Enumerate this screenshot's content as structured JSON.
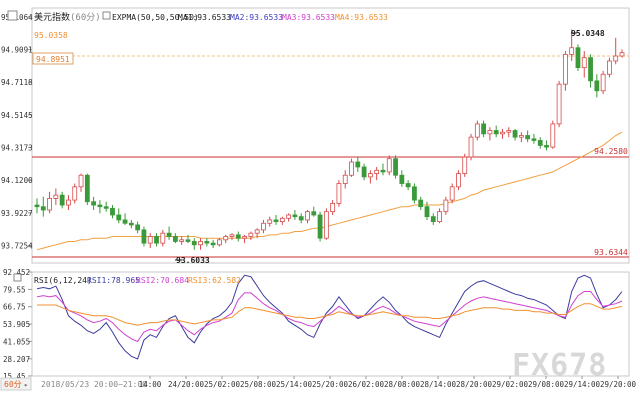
{
  "header": {
    "title": "美元指数",
    "period": "(60分)",
    "ema_label": "EXPMA(50,50,50,50)",
    "ma1": "MA1:93.6533",
    "ma2": "MA2:93.6533",
    "ma3": "MA3:93.6533",
    "ma4": "MA4:93.6533"
  },
  "price_axis": {
    "ticks": [
      "95.1064",
      "94.9091",
      "94.7118",
      "94.5145",
      "94.3173",
      "94.1200",
      "93.9227",
      "93.7254"
    ],
    "top_label": "95.0358",
    "current_label": "94.8951"
  },
  "reference_lines": {
    "resistance": "94.2580",
    "support": "93.6344"
  },
  "annotations": {
    "high": "95.0348",
    "low": "93.6033"
  },
  "rsi_header": {
    "label": "RSI(6,12,24)",
    "rsi1": "RSI1:78.965",
    "rsi2": "RSI2:70.684",
    "rsi3": "RSI3:62.582"
  },
  "rsi_axis": {
    "ticks": [
      "92.452",
      "79.55",
      "66.75",
      "53.905",
      "41.055",
      "28.207",
      "15.45"
    ]
  },
  "time_axis": {
    "period_label": "60分",
    "start_label": "2018/05/23 20:00~21:00",
    "ticks": [
      "14:00",
      "24/20:00",
      "25/02:00",
      "25/08:00",
      "25/14:00",
      "25/20:00",
      "26/02:00",
      "28/08:00",
      "28/14:00",
      "28/20:00",
      "29/02:00",
      "29/08:00",
      "29/14:00",
      "29/20:00"
    ]
  },
  "watermark": "FX678",
  "colors": {
    "up": "#d84a4a",
    "down": "#3a9a3a",
    "ema": "#f0a040",
    "hline": "#c83232",
    "dash": "#f0c080",
    "rsi1": "#3c3ca0",
    "rsi2": "#d040d0",
    "rsi3": "#f09030"
  },
  "chart_data": {
    "type": "candlestick",
    "price_range": [
      93.62,
      95.16
    ],
    "rsi_range": [
      15.45,
      92.452
    ],
    "candles": [
      [
        93.97,
        94.01,
        93.92,
        93.96
      ],
      [
        93.96,
        94.02,
        93.9,
        93.94
      ],
      [
        93.94,
        94.05,
        93.92,
        94.01
      ],
      [
        94.01,
        94.07,
        93.97,
        94.03
      ],
      [
        94.03,
        94.05,
        93.95,
        93.97
      ],
      [
        93.97,
        94.03,
        93.94,
        94.0
      ],
      [
        94.0,
        94.1,
        93.98,
        94.08
      ],
      [
        94.08,
        94.16,
        94.05,
        94.15
      ],
      [
        94.15,
        94.16,
        93.97,
        93.99
      ],
      [
        93.99,
        94.02,
        93.94,
        93.97
      ],
      [
        93.97,
        94.0,
        93.92,
        93.96
      ],
      [
        93.96,
        93.99,
        93.93,
        93.95
      ],
      [
        93.95,
        93.97,
        93.89,
        93.91
      ],
      [
        93.91,
        93.95,
        93.86,
        93.88
      ],
      [
        93.88,
        93.92,
        93.85,
        93.86
      ],
      [
        93.86,
        93.88,
        93.83,
        93.85
      ],
      [
        93.85,
        93.87,
        93.8,
        93.82
      ],
      [
        93.82,
        93.84,
        93.72,
        93.74
      ],
      [
        93.74,
        93.8,
        93.71,
        93.78
      ],
      [
        93.78,
        93.8,
        93.72,
        93.74
      ],
      [
        93.74,
        93.82,
        93.72,
        93.8
      ],
      [
        93.8,
        93.84,
        93.76,
        93.78
      ],
      [
        93.78,
        93.8,
        93.74,
        93.75
      ],
      [
        93.75,
        93.78,
        93.73,
        93.76
      ],
      [
        93.76,
        93.79,
        93.74,
        93.75
      ],
      [
        93.75,
        93.77,
        93.7,
        93.73
      ],
      [
        93.73,
        93.77,
        93.7,
        93.75
      ],
      [
        93.75,
        93.77,
        93.72,
        93.74
      ],
      [
        93.74,
        93.76,
        93.71,
        93.73
      ],
      [
        93.73,
        93.77,
        93.72,
        93.76
      ],
      [
        93.76,
        93.79,
        93.74,
        93.78
      ],
      [
        93.78,
        93.8,
        93.76,
        93.79
      ],
      [
        93.79,
        93.81,
        93.75,
        93.77
      ],
      [
        93.77,
        93.79,
        93.74,
        93.78
      ],
      [
        93.78,
        93.81,
        93.76,
        93.8
      ],
      [
        93.8,
        93.83,
        93.77,
        93.82
      ],
      [
        93.82,
        93.88,
        93.8,
        93.86
      ],
      [
        93.86,
        93.9,
        93.84,
        93.88
      ],
      [
        93.88,
        93.91,
        93.85,
        93.87
      ],
      [
        93.87,
        93.9,
        93.85,
        93.89
      ],
      [
        93.89,
        93.92,
        93.87,
        93.91
      ],
      [
        93.91,
        93.94,
        93.88,
        93.9
      ],
      [
        93.9,
        93.92,
        93.86,
        93.88
      ],
      [
        93.88,
        93.94,
        93.86,
        93.93
      ],
      [
        93.93,
        93.96,
        93.9,
        93.91
      ],
      [
        93.91,
        93.93,
        93.75,
        93.77
      ],
      [
        93.77,
        93.95,
        93.76,
        93.93
      ],
      [
        93.93,
        94.0,
        93.91,
        93.98
      ],
      [
        93.98,
        94.12,
        93.96,
        94.1
      ],
      [
        94.1,
        94.18,
        94.07,
        94.15
      ],
      [
        94.15,
        94.25,
        94.14,
        94.23
      ],
      [
        94.23,
        94.26,
        94.17,
        94.2
      ],
      [
        94.2,
        94.22,
        94.12,
        94.14
      ],
      [
        94.14,
        94.18,
        94.1,
        94.16
      ],
      [
        94.16,
        94.2,
        94.12,
        94.18
      ],
      [
        94.18,
        94.22,
        94.15,
        94.17
      ],
      [
        94.17,
        94.27,
        94.15,
        94.25
      ],
      [
        94.25,
        94.27,
        94.13,
        94.15
      ],
      [
        94.15,
        94.18,
        94.08,
        94.1
      ],
      [
        94.1,
        94.12,
        94.06,
        94.08
      ],
      [
        94.08,
        94.1,
        93.98,
        94.0
      ],
      [
        94.0,
        94.02,
        93.94,
        93.96
      ],
      [
        93.96,
        93.99,
        93.88,
        93.9
      ],
      [
        93.9,
        93.92,
        93.85,
        93.87
      ],
      [
        93.87,
        93.95,
        93.86,
        93.93
      ],
      [
        93.93,
        94.02,
        93.91,
        94.0
      ],
      [
        94.0,
        94.1,
        93.98,
        94.08
      ],
      [
        94.08,
        94.18,
        94.06,
        94.16
      ],
      [
        94.16,
        94.28,
        94.14,
        94.26
      ],
      [
        94.26,
        94.4,
        94.24,
        94.38
      ],
      [
        94.38,
        94.48,
        94.36,
        94.46
      ],
      [
        94.46,
        94.48,
        94.38,
        94.4
      ],
      [
        94.4,
        94.44,
        94.36,
        94.42
      ],
      [
        94.42,
        94.45,
        94.38,
        94.4
      ],
      [
        94.4,
        94.43,
        94.37,
        94.41
      ],
      [
        94.41,
        94.44,
        94.38,
        94.42
      ],
      [
        94.42,
        94.43,
        94.36,
        94.38
      ],
      [
        94.38,
        94.41,
        94.35,
        94.39
      ],
      [
        94.39,
        94.42,
        94.35,
        94.37
      ],
      [
        94.37,
        94.4,
        94.34,
        94.36
      ],
      [
        94.36,
        94.38,
        94.31,
        94.33
      ],
      [
        94.33,
        94.36,
        94.3,
        94.32
      ],
      [
        94.32,
        94.48,
        94.31,
        94.46
      ],
      [
        94.46,
        94.72,
        94.44,
        94.7
      ],
      [
        94.7,
        94.9,
        94.66,
        94.88
      ],
      [
        94.88,
        95.03,
        94.84,
        94.92
      ],
      [
        94.92,
        94.94,
        94.78,
        94.8
      ],
      [
        94.8,
        94.9,
        94.74,
        94.86
      ],
      [
        94.86,
        94.88,
        94.68,
        94.72
      ],
      [
        94.72,
        94.76,
        94.62,
        94.66
      ],
      [
        94.66,
        94.78,
        94.64,
        94.76
      ],
      [
        94.76,
        94.86,
        94.74,
        94.84
      ],
      [
        94.84,
        94.98,
        94.82,
        94.87
      ],
      [
        94.87,
        94.91,
        94.86,
        94.89
      ]
    ],
    "ema": [
      93.7,
      93.71,
      93.72,
      93.73,
      93.74,
      93.75,
      93.75,
      93.76,
      93.76,
      93.77,
      93.77,
      93.77,
      93.78,
      93.78,
      93.78,
      93.78,
      93.78,
      93.78,
      93.78,
      93.78,
      93.78,
      93.78,
      93.78,
      93.78,
      93.78,
      93.78,
      93.77,
      93.77,
      93.77,
      93.77,
      93.77,
      93.77,
      93.77,
      93.77,
      93.77,
      93.78,
      93.78,
      93.79,
      93.79,
      93.8,
      93.8,
      93.81,
      93.81,
      93.82,
      93.83,
      93.83,
      93.84,
      93.85,
      93.86,
      93.87,
      93.88,
      93.89,
      93.9,
      93.91,
      93.92,
      93.93,
      93.94,
      93.95,
      93.96,
      93.96,
      93.97,
      93.97,
      93.97,
      93.97,
      93.97,
      93.98,
      93.99,
      94.0,
      94.01,
      94.03,
      94.04,
      94.06,
      94.07,
      94.08,
      94.09,
      94.1,
      94.11,
      94.12,
      94.13,
      94.14,
      94.15,
      94.16,
      94.17,
      94.19,
      94.21,
      94.23,
      94.25,
      94.27,
      94.29,
      94.31,
      94.33,
      94.36,
      94.39,
      94.41
    ],
    "rsi_lines": [
      {
        "name": "RSI1",
        "values": [
          80,
          81,
          80,
          82,
          72,
          60,
          56,
          53,
          49,
          47,
          50,
          55,
          48,
          40,
          34,
          30,
          28,
          42,
          46,
          44,
          52,
          58,
          60,
          52,
          44,
          40,
          48,
          54,
          58,
          60,
          64,
          70,
          84,
          90,
          89,
          82,
          75,
          70,
          66,
          62,
          56,
          53,
          50,
          46,
          44,
          54,
          62,
          67,
          74,
          68,
          62,
          58,
          60,
          65,
          70,
          74,
          70,
          64,
          60,
          55,
          52,
          50,
          48,
          46,
          44,
          54,
          62,
          70,
          78,
          82,
          85,
          86,
          84,
          82,
          80,
          78,
          76,
          75,
          73,
          72,
          70,
          68,
          64,
          60,
          58,
          78,
          88,
          90,
          88,
          76,
          66,
          68,
          72,
          78
        ]
      },
      {
        "name": "RSI2",
        "values": [
          74,
          75,
          74,
          75,
          70,
          64,
          62,
          60,
          57,
          55,
          56,
          58,
          55,
          50,
          46,
          43,
          41,
          48,
          50,
          49,
          53,
          56,
          57,
          53,
          49,
          46,
          50,
          53,
          55,
          56,
          59,
          62,
          72,
          77,
          77,
          73,
          69,
          66,
          64,
          61,
          58,
          56,
          55,
          53,
          52,
          56,
          60,
          63,
          67,
          64,
          61,
          59,
          60,
          62,
          65,
          67,
          65,
          62,
          60,
          58,
          56,
          55,
          54,
          53,
          52,
          56,
          60,
          64,
          68,
          71,
          73,
          74,
          73,
          72,
          71,
          70,
          69,
          68,
          67,
          66,
          65,
          64,
          62,
          60,
          59,
          68,
          75,
          78,
          78,
          72,
          67,
          68,
          69,
          71
        ]
      },
      {
        "name": "RSI3",
        "values": [
          68,
          68,
          68,
          68,
          66,
          64,
          63,
          62,
          61,
          60,
          60,
          60,
          59,
          57,
          55,
          54,
          53,
          54,
          55,
          55,
          56,
          57,
          57,
          56,
          55,
          54,
          55,
          56,
          57,
          57,
          58,
          59,
          63,
          66,
          66,
          65,
          64,
          63,
          62,
          61,
          60,
          59,
          59,
          58,
          58,
          59,
          60,
          61,
          63,
          62,
          61,
          60,
          60,
          61,
          62,
          63,
          62,
          61,
          60,
          60,
          59,
          59,
          59,
          58,
          58,
          59,
          60,
          61,
          63,
          64,
          65,
          66,
          66,
          66,
          65,
          65,
          64,
          64,
          64,
          63,
          63,
          62,
          62,
          61,
          61,
          64,
          67,
          69,
          69,
          67,
          65,
          65,
          66,
          67
        ]
      }
    ]
  }
}
